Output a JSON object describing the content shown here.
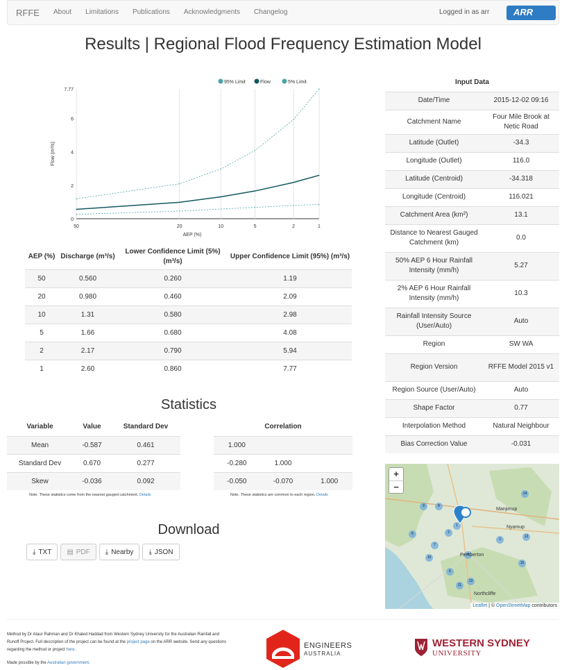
{
  "nav": {
    "brand": "RFFE",
    "links": [
      "About",
      "Limitations",
      "Publications",
      "Acknowledgments",
      "Changelog"
    ],
    "logged_in": "Logged in as arr",
    "logo": "ARR"
  },
  "title": "Results | Regional Flood Frequency Estimation Model",
  "chart_data": {
    "type": "line",
    "x_label": "AEP (%)",
    "y_label": "Flow (m³/s)",
    "x_ticks": [
      "50",
      "20",
      "10",
      "5",
      "2",
      "1"
    ],
    "y_ticks": [
      "0",
      "2",
      "4",
      "6",
      "7.77"
    ],
    "ylim": [
      0,
      7.77
    ],
    "legend": [
      "95% Limit",
      "Flow",
      "5% Limit"
    ],
    "legend_position": "top",
    "series": [
      {
        "name": "95% Limit",
        "x": [
          50,
          20,
          10,
          5,
          2,
          1
        ],
        "values": [
          1.19,
          2.09,
          2.98,
          4.08,
          5.94,
          7.77
        ],
        "color": "#4aa3a5",
        "style": "dashed"
      },
      {
        "name": "Flow",
        "x": [
          50,
          20,
          10,
          5,
          2,
          1
        ],
        "values": [
          0.56,
          0.98,
          1.31,
          1.66,
          2.17,
          2.6
        ],
        "color": "#13575f",
        "style": "solid"
      },
      {
        "name": "5% Limit",
        "x": [
          50,
          20,
          10,
          5,
          2,
          1
        ],
        "values": [
          0.26,
          0.46,
          0.58,
          0.68,
          0.79,
          0.86
        ],
        "color": "#4aa3a5",
        "style": "dashed"
      }
    ]
  },
  "results": {
    "headers": [
      "AEP (%)",
      "Discharge (m³/s)",
      "Lower Confidence Limit (5%) (m³/s)",
      "Upper Confidence Limit (95%) (m³/s)"
    ],
    "rows": [
      [
        "50",
        "0.560",
        "0.260",
        "1.19"
      ],
      [
        "20",
        "0.980",
        "0.460",
        "2.09"
      ],
      [
        "10",
        "1.31",
        "0.580",
        "2.98"
      ],
      [
        "5",
        "1.66",
        "0.680",
        "4.08"
      ],
      [
        "2",
        "2.17",
        "0.790",
        "5.94"
      ],
      [
        "1",
        "2.60",
        "0.860",
        "7.77"
      ]
    ]
  },
  "statistics": {
    "title": "Statistics",
    "headers": [
      "Variable",
      "Value",
      "Standard Dev"
    ],
    "rows": [
      [
        "Mean",
        "-0.587",
        "0.461"
      ],
      [
        "Standard Dev",
        "0.670",
        "0.277"
      ],
      [
        "Skew",
        "-0.036",
        "0.092"
      ]
    ],
    "note": "Note. These statistics come from the nearest gauged catchment.",
    "note_link": "Details",
    "correlation_title": "Correlation",
    "correlation": [
      [
        "1.000",
        "",
        ""
      ],
      [
        "-0.280",
        "1.000",
        ""
      ],
      [
        "-0.050",
        "-0.070",
        "1.000"
      ]
    ],
    "corr_note": "Note. These statistics are common to each region.",
    "corr_note_link": "Details"
  },
  "download": {
    "title": "Download",
    "buttons": [
      "TXT",
      "PDF",
      "Nearby",
      "JSON"
    ]
  },
  "input": {
    "title": "Input Data",
    "rows": [
      [
        "Date/Time",
        "2015-12-02 09:16"
      ],
      [
        "Catchment Name",
        "Four Mile Brook at Netic Road"
      ],
      [
        "Latitude (Outlet)",
        "-34.3"
      ],
      [
        "Longitude (Outlet)",
        "116.0"
      ],
      [
        "Latitude (Centroid)",
        "-34.318"
      ],
      [
        "Longitude (Centroid)",
        "116.021"
      ],
      [
        "Catchment Area (km²)",
        "13.1"
      ],
      [
        "Distance to Nearest Gauged Catchment (km)",
        "0.0"
      ],
      [
        "50% AEP 6 Hour Rainfall Intensity (mm/h)",
        "5.27"
      ],
      [
        "2% AEP 6 Hour Rainfall Intensity (mm/h)",
        "10.3"
      ],
      [
        "Rainfall Intensity Source (User/Auto)",
        "Auto"
      ],
      [
        "Region",
        "SW WA"
      ],
      [
        "Region Version",
        "RFFE Model 2015 v1"
      ],
      [
        "Region Source (User/Auto)",
        "Auto"
      ],
      [
        "Shape Factor",
        "0.77"
      ],
      [
        "Interpolation Method",
        "Natural Neighbour"
      ],
      [
        "Bias Correction Value",
        "-0.031"
      ]
    ]
  },
  "map": {
    "zoom_in": "+",
    "zoom_out": "−",
    "attr_leaflet": "Leaflet",
    "attr_sep": " | © ",
    "attr_osm": "OpenStreetMap",
    "attr_tail": " contributors",
    "places": [
      "Manjimup",
      "Nyamup",
      "Pemberton",
      "Northcliffe"
    ],
    "markers": [
      "14",
      "9",
      "8",
      "5",
      "2",
      "1",
      "7",
      "4",
      "3",
      "10",
      "12",
      "13",
      "15",
      "11",
      "6"
    ]
  },
  "footer": {
    "line1": "Method by Dr Ataur Rahman and Dr Khaled Haddad from Western Sydney University for the Australian Rainfall and Runoff Project. Full description of the project can be found at the ",
    "link1": "project page",
    "line1b": " on the ARR website. Send any questions regarding the method or project ",
    "link2": "here",
    "line1c": ".",
    "line2": "Made possible by the ",
    "link3": "Australian government",
    "line2b": ".",
    "ea_1": "ENGINEERS",
    "ea_2": "AUSTRALIA",
    "wsu_1": "WESTERN SYDNEY",
    "wsu_2": "UNIVERSITY"
  }
}
